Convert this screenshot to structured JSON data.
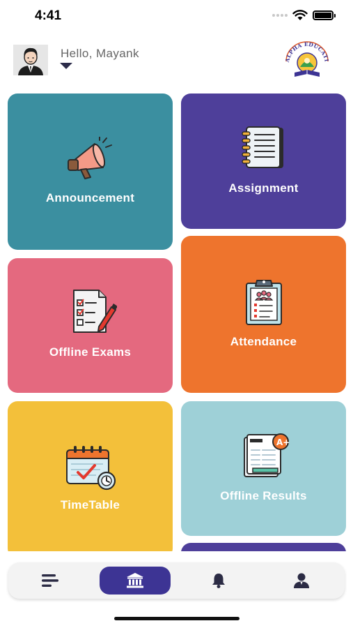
{
  "status_bar": {
    "time": "4:41",
    "icons": [
      "signal-dots-icon",
      "wifi-icon",
      "battery-icon"
    ]
  },
  "header": {
    "greeting": "Hello, Mayank",
    "avatar_icon": "user-avatar-icon",
    "logo_icon": "alpha-education-logo-icon"
  },
  "tiles": [
    {
      "label": "Announcement",
      "icon": "megaphone-icon",
      "color": "#3b8fa0"
    },
    {
      "label": "Assignment",
      "icon": "notebook-icon",
      "color": "#4e3f9a"
    },
    {
      "label": "Offline Exams",
      "icon": "exam-paper-icon",
      "color": "#e4697f"
    },
    {
      "label": "Attendance",
      "icon": "clipboard-icon",
      "color": "#ee742d"
    },
    {
      "label": "TimeTable",
      "icon": "calendar-icon",
      "color": "#f3c03a"
    },
    {
      "label": "Offline Results",
      "icon": "result-sheet-icon",
      "color": "#9ed0d7"
    },
    {
      "label": "",
      "icon": "",
      "color": "#4e3f9a"
    }
  ],
  "bottom_nav": {
    "items": [
      {
        "icon": "menu-icon",
        "active": false
      },
      {
        "icon": "home-institution-icon",
        "active": true
      },
      {
        "icon": "bell-icon",
        "active": false
      },
      {
        "icon": "profile-icon",
        "active": false
      }
    ],
    "accent_color": "#3d3494"
  }
}
